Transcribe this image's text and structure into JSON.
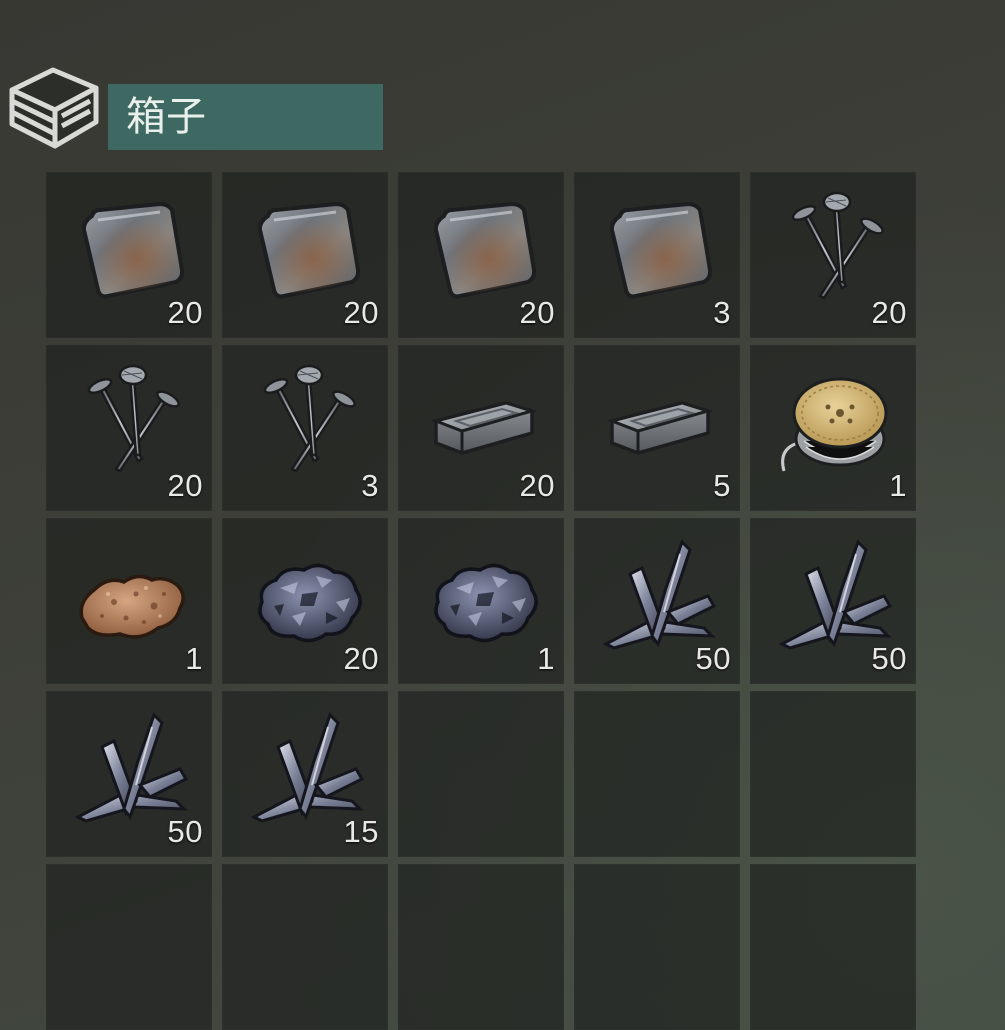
{
  "container": {
    "title": "箱子",
    "icon": "crate-icon"
  },
  "inventory": {
    "slots": [
      {
        "item": "metal-sheet-icon",
        "count": "20"
      },
      {
        "item": "metal-sheet-icon",
        "count": "20"
      },
      {
        "item": "metal-sheet-icon",
        "count": "20"
      },
      {
        "item": "metal-sheet-icon",
        "count": "3"
      },
      {
        "item": "nails-icon",
        "count": "20"
      },
      {
        "item": "nails-icon",
        "count": "20"
      },
      {
        "item": "nails-icon",
        "count": "3"
      },
      {
        "item": "iron-ingot-icon",
        "count": "20"
      },
      {
        "item": "iron-ingot-icon",
        "count": "5"
      },
      {
        "item": "wire-spool-icon",
        "count": "1"
      },
      {
        "item": "copper-ore-icon",
        "count": "1"
      },
      {
        "item": "iron-ore-icon",
        "count": "20"
      },
      {
        "item": "iron-ore-icon",
        "count": "1"
      },
      {
        "item": "scrap-metal-icon",
        "count": "50"
      },
      {
        "item": "scrap-metal-icon",
        "count": "50"
      },
      {
        "item": "scrap-metal-icon",
        "count": "50"
      },
      {
        "item": "scrap-metal-icon",
        "count": "15"
      },
      {
        "item": "",
        "count": ""
      },
      {
        "item": "",
        "count": ""
      },
      {
        "item": "",
        "count": ""
      },
      {
        "item": "",
        "count": ""
      },
      {
        "item": "",
        "count": ""
      },
      {
        "item": "",
        "count": ""
      },
      {
        "item": "",
        "count": ""
      },
      {
        "item": "",
        "count": ""
      }
    ]
  },
  "colors": {
    "title_bar": "#3e6862",
    "slot_bg": "#262925",
    "count_text": "#e8e8e4"
  }
}
